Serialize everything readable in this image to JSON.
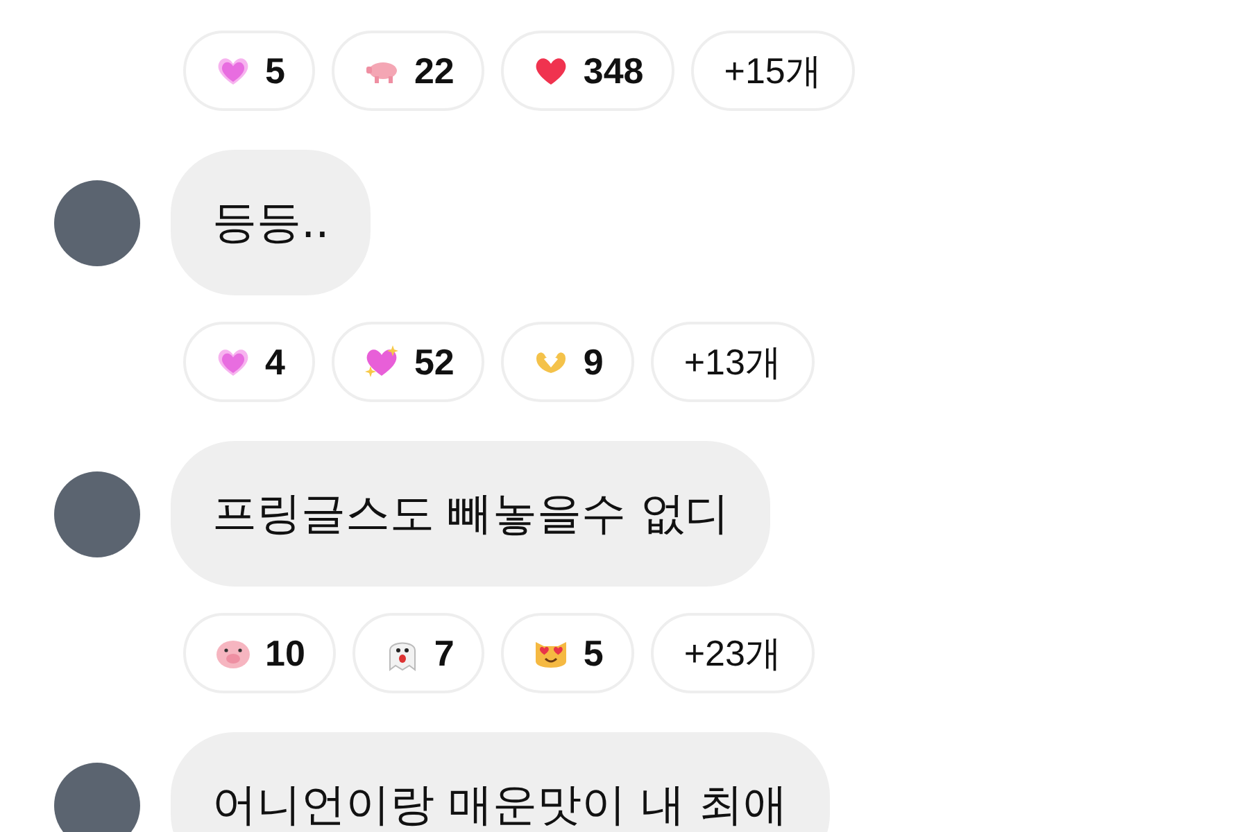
{
  "messages": [
    {
      "reactions": [
        {
          "kind": "glowing-heart",
          "count": "5"
        },
        {
          "kind": "pig",
          "count": "22"
        },
        {
          "kind": "red-heart",
          "count": "348"
        },
        {
          "kind": "more",
          "count": "+15개"
        }
      ]
    },
    {
      "text": "등등..",
      "reactions": [
        {
          "kind": "glowing-heart",
          "count": "4"
        },
        {
          "kind": "sparkling-heart",
          "count": "52"
        },
        {
          "kind": "heart-hands",
          "count": "9"
        },
        {
          "kind": "more",
          "count": "+13개"
        }
      ]
    },
    {
      "text": "프링글스도 빼놓을수 없디",
      "reactions": [
        {
          "kind": "pig-face",
          "count": "10"
        },
        {
          "kind": "ghost",
          "count": "7"
        },
        {
          "kind": "cat-heart-eyes",
          "count": "5"
        },
        {
          "kind": "more",
          "count": "+23개"
        }
      ]
    },
    {
      "text": "어니언이랑 매운맛이 내 최애"
    }
  ]
}
